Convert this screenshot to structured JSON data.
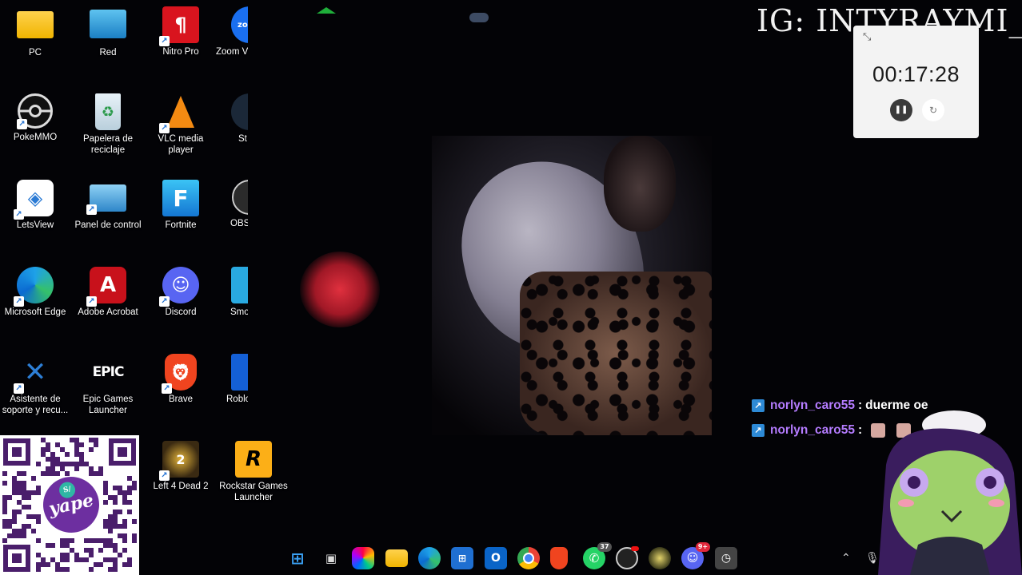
{
  "desktop": {
    "col1": [
      {
        "label": "PC",
        "icon": "folder-icon"
      },
      {
        "label": "PokeMMO",
        "icon": "pokeball-icon"
      },
      {
        "label": "LetsView",
        "icon": "letsview-icon"
      },
      {
        "label": "Microsoft Edge",
        "icon": "edge-icon"
      },
      {
        "label": "Asistente de soporte y recu...",
        "icon": "wrench-icon"
      }
    ],
    "col2": [
      {
        "label": "Red",
        "icon": "network-icon"
      },
      {
        "label": "Papelera de reciclaje",
        "icon": "recycle-bin-icon"
      },
      {
        "label": "Panel de control",
        "icon": "control-panel-icon"
      },
      {
        "label": "Adobe Acrobat",
        "icon": "acrobat-icon"
      },
      {
        "label": "Epic Games Launcher",
        "icon": "epic-games-icon",
        "glyph": "EPIC"
      }
    ],
    "col3": [
      {
        "label": "Nitro Pro",
        "icon": "nitro-icon"
      },
      {
        "label": "VLC media player",
        "icon": "vlc-icon"
      },
      {
        "label": "Fortnite",
        "icon": "fortnite-icon",
        "glyph": "F"
      },
      {
        "label": "Discord",
        "icon": "discord-icon"
      },
      {
        "label": "Brave",
        "icon": "brave-icon"
      },
      {
        "label": "Left 4 Dead 2",
        "icon": "l4d2-icon"
      }
    ],
    "col4": [
      {
        "label": "Zoom V",
        "icon": "zoom-icon"
      },
      {
        "label": "St",
        "icon": "steam-icon"
      },
      {
        "label": "OBS",
        "icon": "obs-icon"
      },
      {
        "label": "Smo",
        "icon": "smo-icon"
      },
      {
        "label": "Roblo",
        "icon": "roblox-icon"
      }
    ],
    "extra": {
      "label": "Rockstar Games Launcher",
      "icon": "rockstar-icon",
      "glyph": "R"
    }
  },
  "overlay": {
    "instagram": "IG: INTYRAYMI_"
  },
  "timer": {
    "time": "00:17:28",
    "pause_icon": "pause-icon",
    "reset_icon": "reset-icon"
  },
  "chat": [
    {
      "user": "norlyn_caro55",
      "sep": ":",
      "text": "duerme oe",
      "emotes": 0
    },
    {
      "user": "norlyn_caro55",
      "sep": ":",
      "text": "",
      "emotes": 2
    }
  ],
  "taskbar": {
    "whatsapp_badge": "37",
    "discord_badge": "9+"
  },
  "colors": {
    "chat_user": "#b57cff",
    "qr_purple": "#4a1e6b",
    "yape_purple": "#6d2fa0"
  },
  "qr": {
    "brand": "yape",
    "currency": "S/"
  }
}
